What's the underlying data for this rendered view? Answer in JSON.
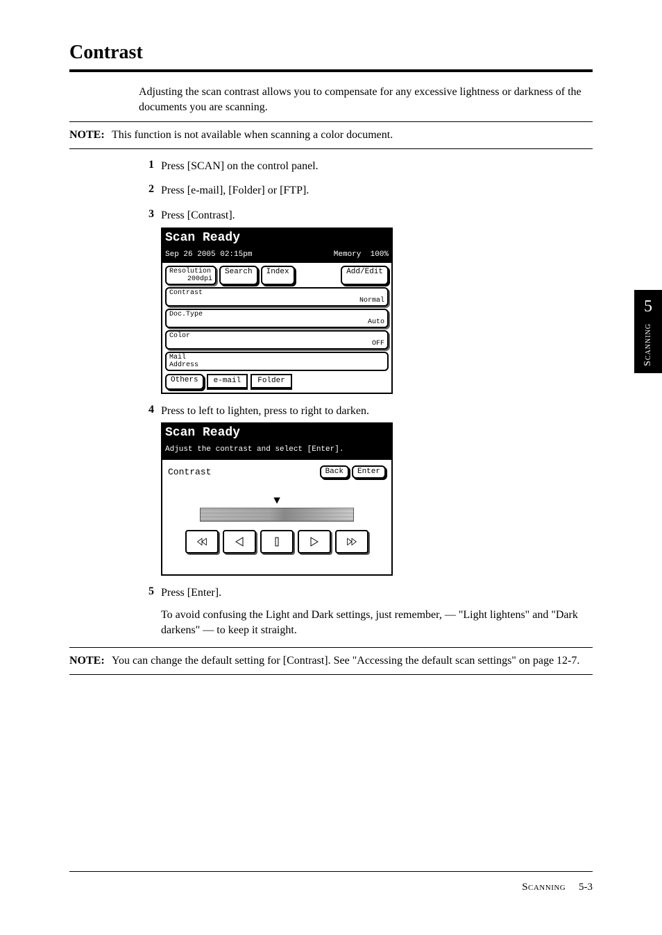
{
  "heading": "Contrast",
  "intro": "Adjusting the scan contrast allows you to compensate for any excessive lightness or darkness of the documents you are scanning.",
  "note1": {
    "label": "NOTE:",
    "text": "This function is not available when scanning a color document."
  },
  "steps": {
    "s1": {
      "num": "1",
      "text": "Press [SCAN] on the control panel."
    },
    "s2": {
      "num": "2",
      "text": "Press [e-mail], [Folder] or [FTP]."
    },
    "s3": {
      "num": "3",
      "text": "Press [Contrast]."
    },
    "s4": {
      "num": "4",
      "text": "Press to left to lighten, press to right to darken."
    },
    "s5": {
      "num": "5",
      "text": "Press [Enter].",
      "extra": "To avoid confusing the Light and Dark settings, just remember, — \"Light lightens\" and \"Dark darkens\" — to keep it straight."
    }
  },
  "screen1": {
    "title": "Scan Ready",
    "datetime": "Sep 26 2005 02:15pm",
    "memory_label": "Memory",
    "memory_value": "100%",
    "resolution": {
      "label": "Resolution",
      "value": "200dpi"
    },
    "search": "Search",
    "index": "Index",
    "add_edit": "Add/Edit",
    "contrast": {
      "label": "Contrast",
      "value": "Normal"
    },
    "doctype": {
      "label": "Doc.Type",
      "value": "Auto"
    },
    "color": {
      "label": "Color",
      "value": "OFF"
    },
    "mail_address": "Mail\nAddress",
    "others": "Others",
    "email_tab": "e-mail",
    "folder_tab": "Folder"
  },
  "screen2": {
    "title": "Scan Ready",
    "subtitle": "Adjust the contrast and select [Enter].",
    "label": "Contrast",
    "back": "Back",
    "enter": "Enter"
  },
  "note2": {
    "label": "NOTE:",
    "text": "You can change the default setting for [Contrast]. See \"Accessing the default scan settings\" on page 12-7."
  },
  "side_tab": {
    "num": "5",
    "label": "Scanning"
  },
  "footer": {
    "section": "Scanning",
    "page": "5-3"
  }
}
